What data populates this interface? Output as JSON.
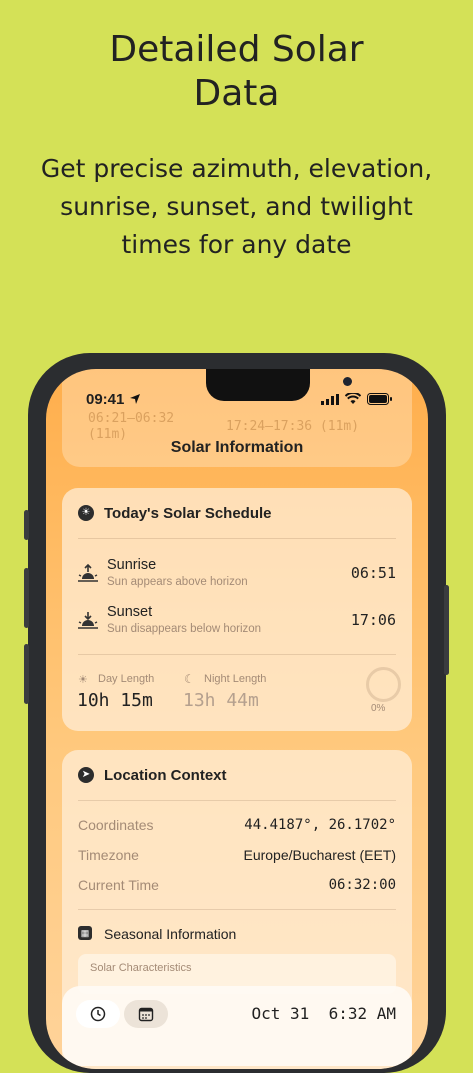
{
  "promo": {
    "headline": "Detailed Solar\nData",
    "subline": "Get precise azimuth, elevation,\nsunrise, sunset, and twilight\ntimes for any date"
  },
  "status_bar": {
    "time": "09:41"
  },
  "background_card": {
    "left_times": "06:21–06:32\n(11m)",
    "right_times": "17:24–17:36 (11m)"
  },
  "nav": {
    "title": "Solar Information"
  },
  "schedule": {
    "title": "Today's Solar Schedule",
    "events": [
      {
        "name": "Sunrise",
        "description": "Sun appears above horizon",
        "time": "06:51",
        "icon": "sunrise-icon"
      },
      {
        "name": "Sunset",
        "description": "Sun disappears below horizon",
        "time": "17:06",
        "icon": "sunset-icon"
      }
    ],
    "day_length_label": "Day Length",
    "day_length_value": "10h 15m",
    "night_length_label": "Night Length",
    "night_length_value": "13h 44m",
    "progress_label": "0%",
    "progress_fraction": 0
  },
  "location": {
    "title": "Location Context",
    "rows": [
      {
        "label": "Coordinates",
        "value": "44.4187°, 26.1702°"
      },
      {
        "label": "Timezone",
        "value": "Europe/Bucharest (EET)"
      },
      {
        "label": "Current Time",
        "value": "06:32:00"
      }
    ],
    "seasonal_title": "Seasonal Information",
    "seasonal_sub": "Solar Characteristics"
  },
  "bottom_bar": {
    "date_display": "Oct 31  6:32 AM",
    "clock_icon": "clock-icon",
    "calendar_icon": "calendar-icon"
  },
  "colors": {
    "background": "#d4e157",
    "screen_top": "#ffae4c",
    "screen_bottom": "#ffd39a"
  }
}
